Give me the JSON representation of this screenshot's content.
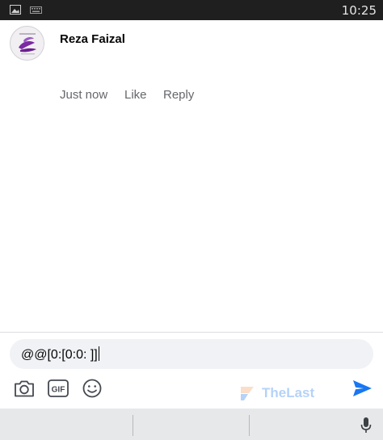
{
  "status_bar": {
    "time": "10:25",
    "icons": [
      "image-icon",
      "keyboard-icon"
    ]
  },
  "comment": {
    "author": "Reza Faizal",
    "actions": {
      "time": "Just now",
      "like": "Like",
      "reply": "Reply"
    }
  },
  "composer": {
    "input_value": "@@[0:[0:0: ]]",
    "tools": [
      "camera-icon",
      "gif-icon",
      "emoji-icon"
    ],
    "send_icon": "send-icon",
    "accent_color": "#1877f2"
  },
  "watermark": {
    "text": "TheLast"
  },
  "keyboard_bar": {
    "icons": [
      "microphone-icon"
    ]
  }
}
